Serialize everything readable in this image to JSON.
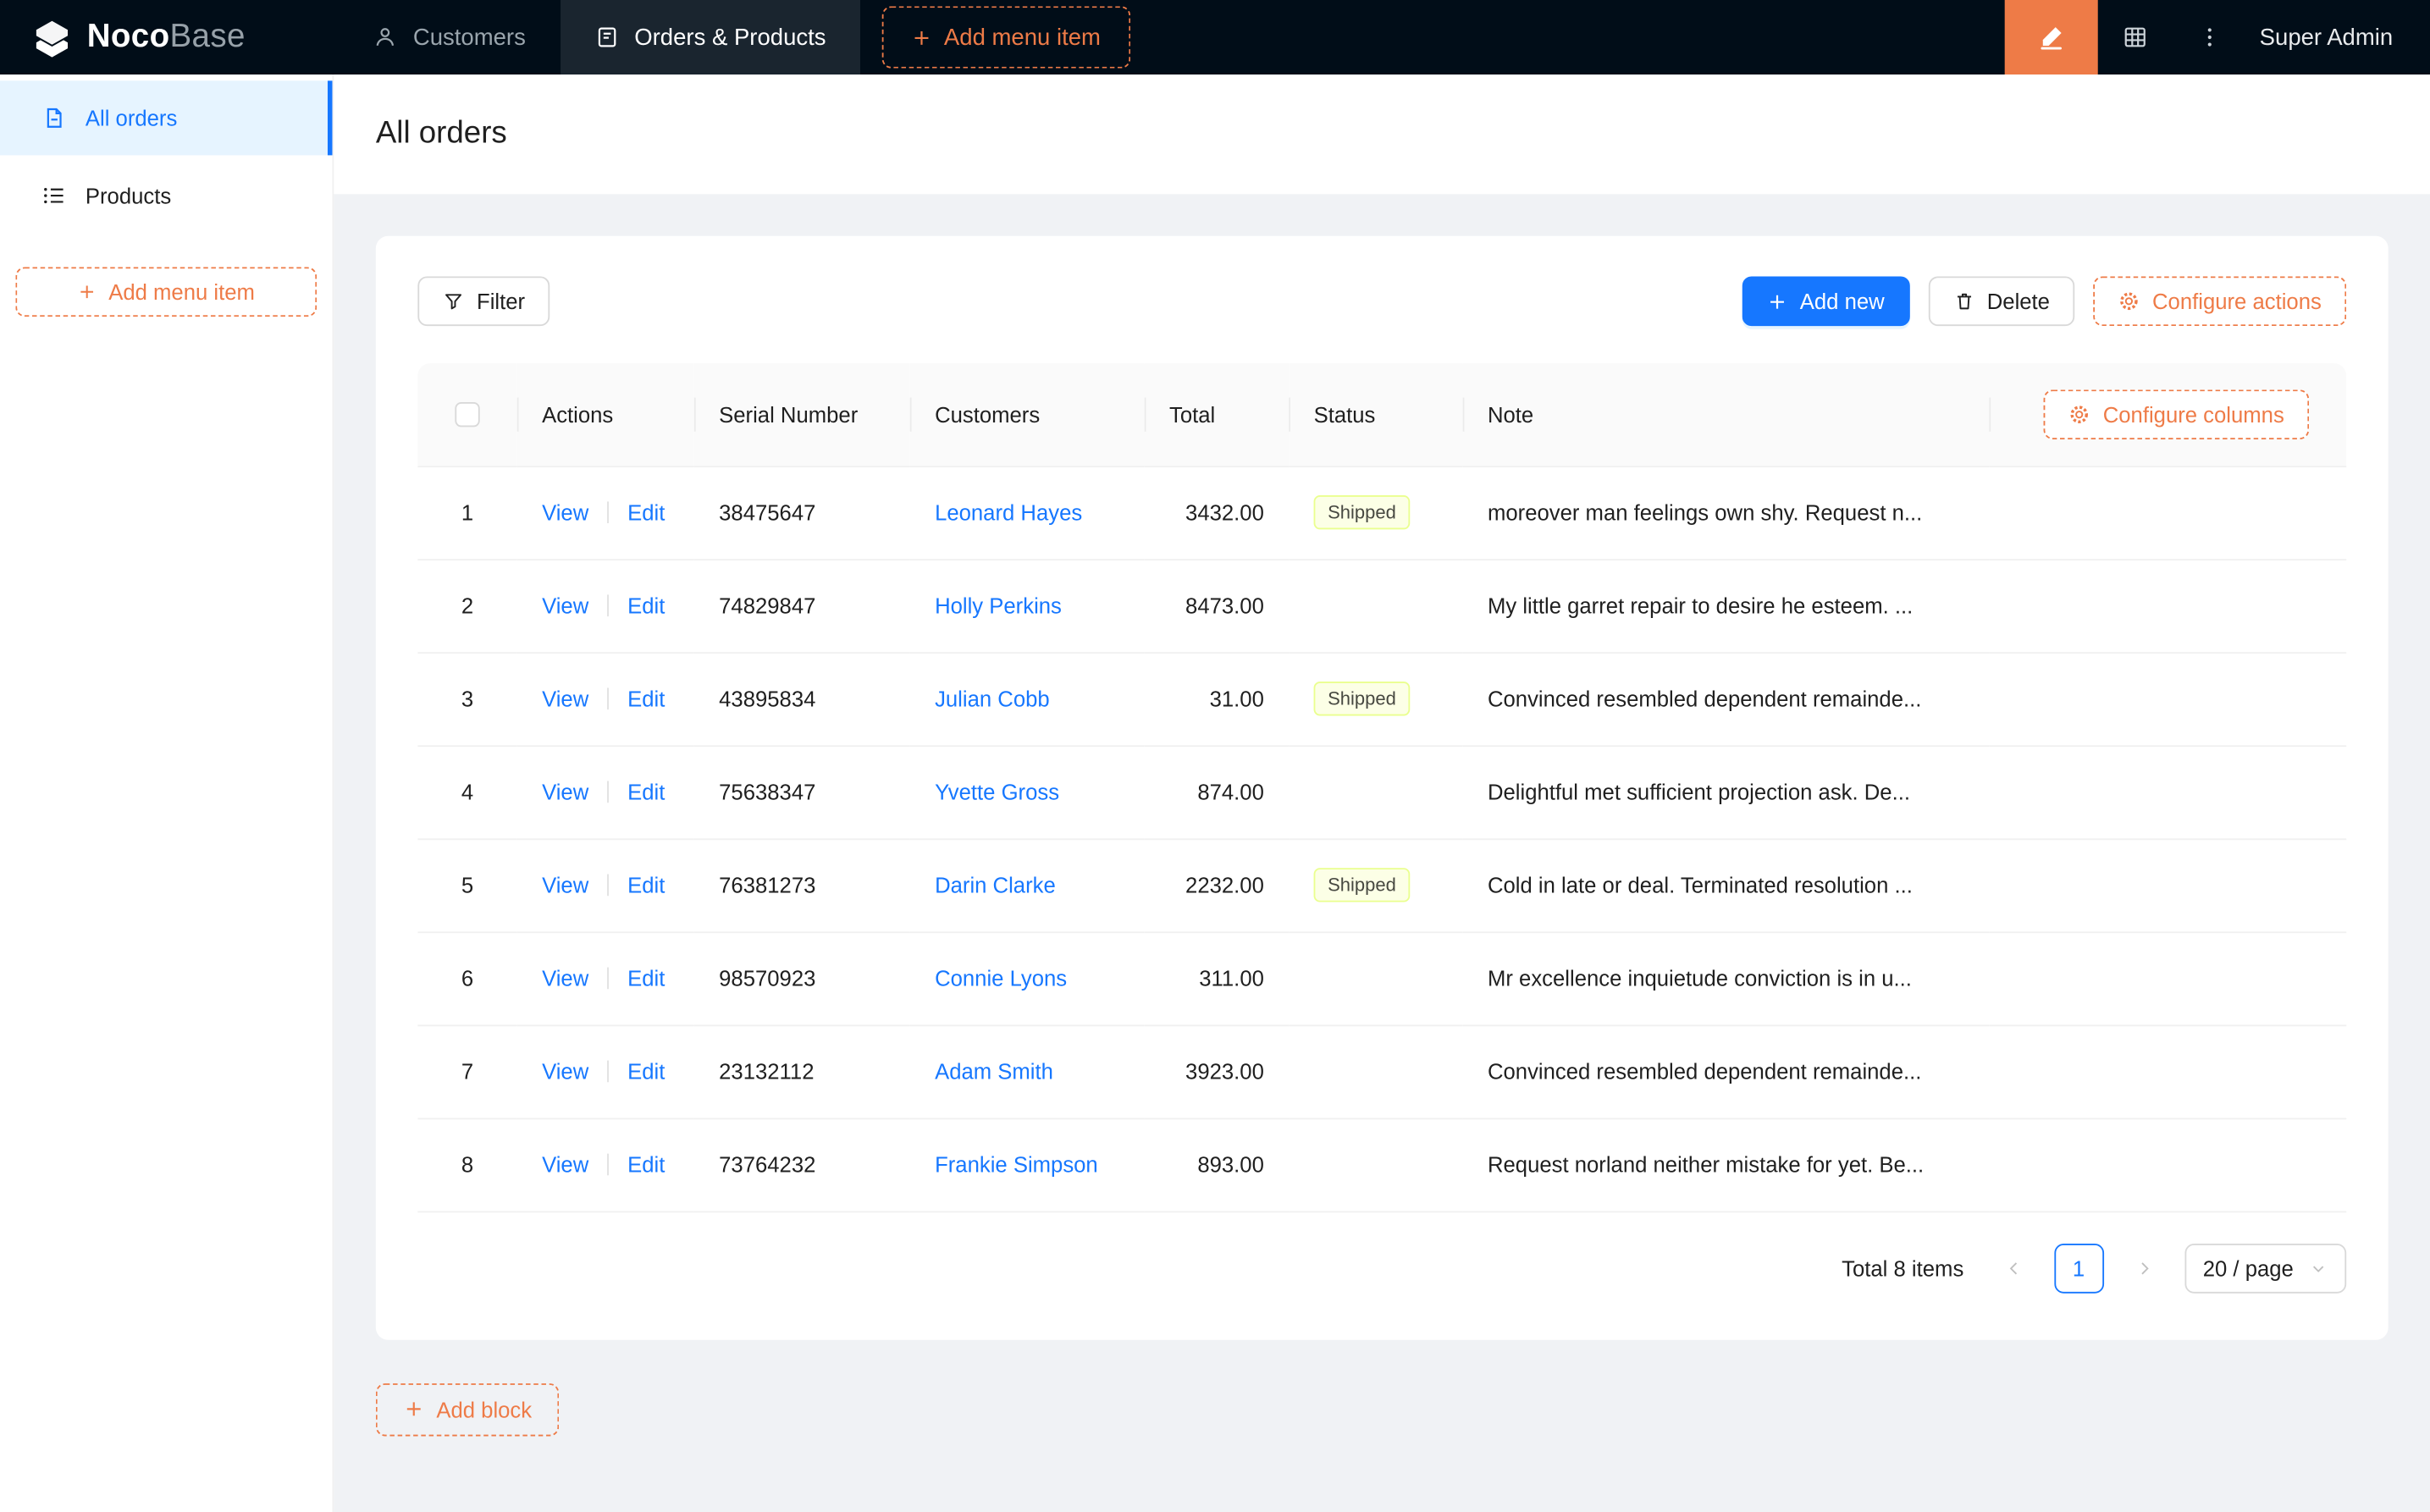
{
  "brand": {
    "name_bold": "Noco",
    "name_light": "Base"
  },
  "topnav": {
    "items": [
      {
        "label": "Customers",
        "icon": "users-icon",
        "active": false
      },
      {
        "label": "Orders & Products",
        "icon": "orders-icon",
        "active": true
      }
    ],
    "add_menu_item_label": "Add menu item",
    "user": "Super Admin"
  },
  "sidebar": {
    "items": [
      {
        "label": "All orders",
        "icon": "page-icon",
        "active": true
      },
      {
        "label": "Products",
        "icon": "list-icon",
        "active": false
      }
    ],
    "add_menu_item_label": "Add menu item"
  },
  "page": {
    "title": "All orders"
  },
  "toolbar": {
    "filter_label": "Filter",
    "add_new_label": "Add new",
    "delete_label": "Delete",
    "configure_actions_label": "Configure actions"
  },
  "table": {
    "configure_columns_label": "Configure columns",
    "columns": [
      "Actions",
      "Serial Number",
      "Customers",
      "Total",
      "Status",
      "Note"
    ],
    "action_labels": {
      "view": "View",
      "edit": "Edit"
    },
    "rows": [
      {
        "index": 1,
        "serial": "38475647",
        "customer": "Leonard Hayes",
        "total": "3432.00",
        "status": "Shipped",
        "note": "moreover man feelings own shy. Request n..."
      },
      {
        "index": 2,
        "serial": "74829847",
        "customer": "Holly Perkins",
        "total": "8473.00",
        "status": "",
        "note": "My little garret repair to desire he esteem. ..."
      },
      {
        "index": 3,
        "serial": "43895834",
        "customer": "Julian Cobb",
        "total": "31.00",
        "status": "Shipped",
        "note": "Convinced resembled dependent remainde..."
      },
      {
        "index": 4,
        "serial": "75638347",
        "customer": "Yvette Gross",
        "total": "874.00",
        "status": "",
        "note": "Delightful met sufficient projection ask. De..."
      },
      {
        "index": 5,
        "serial": "76381273",
        "customer": "Darin Clarke",
        "total": "2232.00",
        "status": "Shipped",
        "note": "Cold in late or deal. Terminated resolution ..."
      },
      {
        "index": 6,
        "serial": "98570923",
        "customer": "Connie Lyons",
        "total": "311.00",
        "status": "",
        "note": "Mr excellence inquietude conviction is in u..."
      },
      {
        "index": 7,
        "serial": "23132112",
        "customer": "Adam Smith",
        "total": "3923.00",
        "status": "",
        "note": "Convinced resembled dependent remainde..."
      },
      {
        "index": 8,
        "serial": "73764232",
        "customer": "Frankie Simpson",
        "total": "893.00",
        "status": "",
        "note": "Request norland neither mistake for yet. Be..."
      }
    ]
  },
  "pagination": {
    "total_label": "Total 8 items",
    "page": "1",
    "page_size_label": "20 / page"
  },
  "add_block_label": "Add block",
  "colors": {
    "accent_blue": "#1677ff",
    "accent_orange": "#ee7b47",
    "nav_bg": "#010d18",
    "content_bg": "#f0f2f5",
    "sidebar_active_bg": "#e6f4ff",
    "status_shipped_bg": "#fcffe6",
    "status_shipped_border": "#eaff8f"
  }
}
